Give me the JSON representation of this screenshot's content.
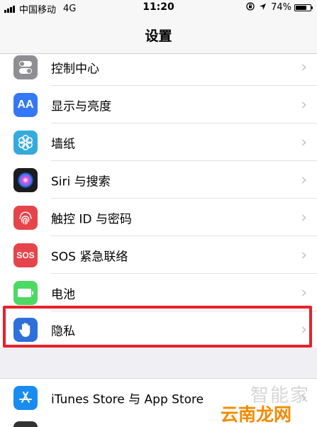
{
  "status_bar": {
    "carrier": "中国移动",
    "network": "4G",
    "time": "11:20",
    "battery_text": "74%",
    "battery_level": 0.74
  },
  "nav": {
    "title": "设置"
  },
  "rows": [
    {
      "label": "控制中心",
      "icon": "control-center-icon",
      "color": "#8e8e93"
    },
    {
      "label": "显示与亮度",
      "icon": "display-brightness-icon",
      "color": "#3478f6"
    },
    {
      "label": "墙纸",
      "icon": "wallpaper-icon",
      "color": "#35aadc"
    },
    {
      "label": "Siri 与搜索",
      "icon": "siri-icon",
      "color": "#1c1c1e"
    },
    {
      "label": "触控 ID 与密码",
      "icon": "fingerprint-icon",
      "color": "#e5454a"
    },
    {
      "label": "SOS 紧急联络",
      "icon": "sos-icon",
      "color": "#e5454a"
    },
    {
      "label": "电池",
      "icon": "battery-icon",
      "color": "#4cd964"
    },
    {
      "label": "隐私",
      "icon": "privacy-hand-icon",
      "color": "#2f6fd9"
    }
  ],
  "rows_group2": [
    {
      "label": "iTunes Store 与 App Store",
      "icon": "app-store-icon",
      "color": "#1a8cf0"
    }
  ],
  "icon_text": {
    "display": "AA",
    "sos": "SOS"
  },
  "watermark": {
    "top": "智能家",
    "bottom": "云南龙网"
  },
  "highlight_color": "#e8212a"
}
